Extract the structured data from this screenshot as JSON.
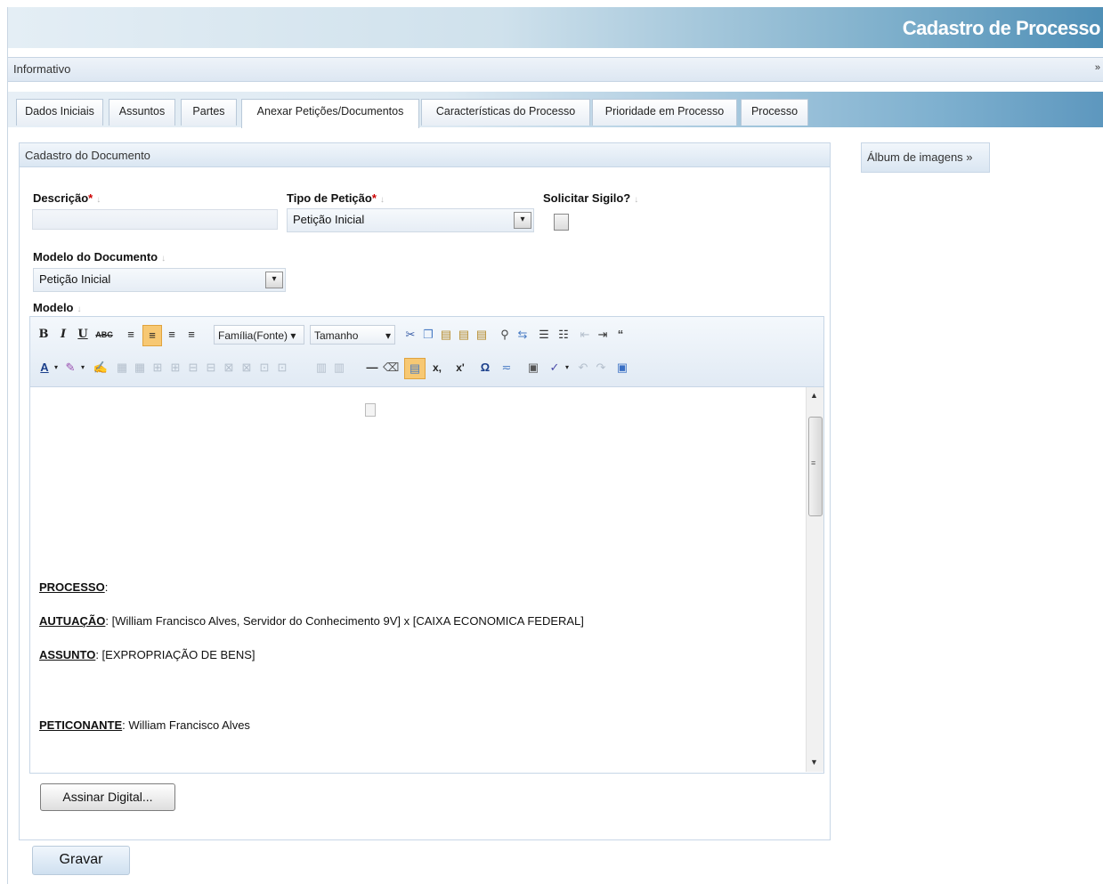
{
  "window": {
    "title": "Cadastro de Processo"
  },
  "info_bar": {
    "label": "Informativo",
    "arrow": "»"
  },
  "tabs": [
    {
      "label": "Dados Iniciais"
    },
    {
      "label": "Assuntos"
    },
    {
      "label": "Partes"
    },
    {
      "label": "Anexar Petições/Documentos",
      "active": true
    },
    {
      "label": "Características do Processo"
    },
    {
      "label": "Prioridade em Processo"
    },
    {
      "label": "Processo"
    }
  ],
  "panel": {
    "title": "Cadastro do Documento"
  },
  "album": {
    "label": "Álbum de imagens »"
  },
  "form": {
    "descricao": {
      "label": "Descrição",
      "required_mark": "*",
      "value": ""
    },
    "tipo_peticao": {
      "label": "Tipo de Petição",
      "required_mark": "*",
      "value": "Petição Inicial"
    },
    "sigilo": {
      "label": "Solicitar Sigilo?",
      "checked": false
    },
    "modelo_documento": {
      "label": "Modelo do Documento",
      "value": "Petição Inicial"
    },
    "modelo": {
      "label": "Modelo"
    }
  },
  "editor": {
    "toolbar": {
      "font_family_label": "Família(Fonte)",
      "size_label": "Tamanho",
      "bold": "B",
      "italic": "I",
      "underline": "U",
      "strike": "ABC",
      "omega": "Ω",
      "subscript": "x,",
      "superscript": "x'"
    },
    "content": [
      {
        "key": "PROCESSO",
        "value": ":"
      },
      {
        "key": "AUTUAÇÃO",
        "value": ": [William Francisco Alves, Servidor do Conhecimento 9V] x [CAIXA ECONOMICA FEDERAL]"
      },
      {
        "key": "ASSUNTO",
        "value": ": [EXPROPRIAÇÃO DE BENS]"
      },
      {
        "key": "PETICONANTE",
        "value": ": William Francisco Alves"
      }
    ]
  },
  "buttons": {
    "assinar": "Assinar Digital...",
    "gravar": "Gravar"
  },
  "colors": {
    "title_bar": "#4f8fb6",
    "required": "#cc0000",
    "panel_header": "#dae6f2"
  }
}
